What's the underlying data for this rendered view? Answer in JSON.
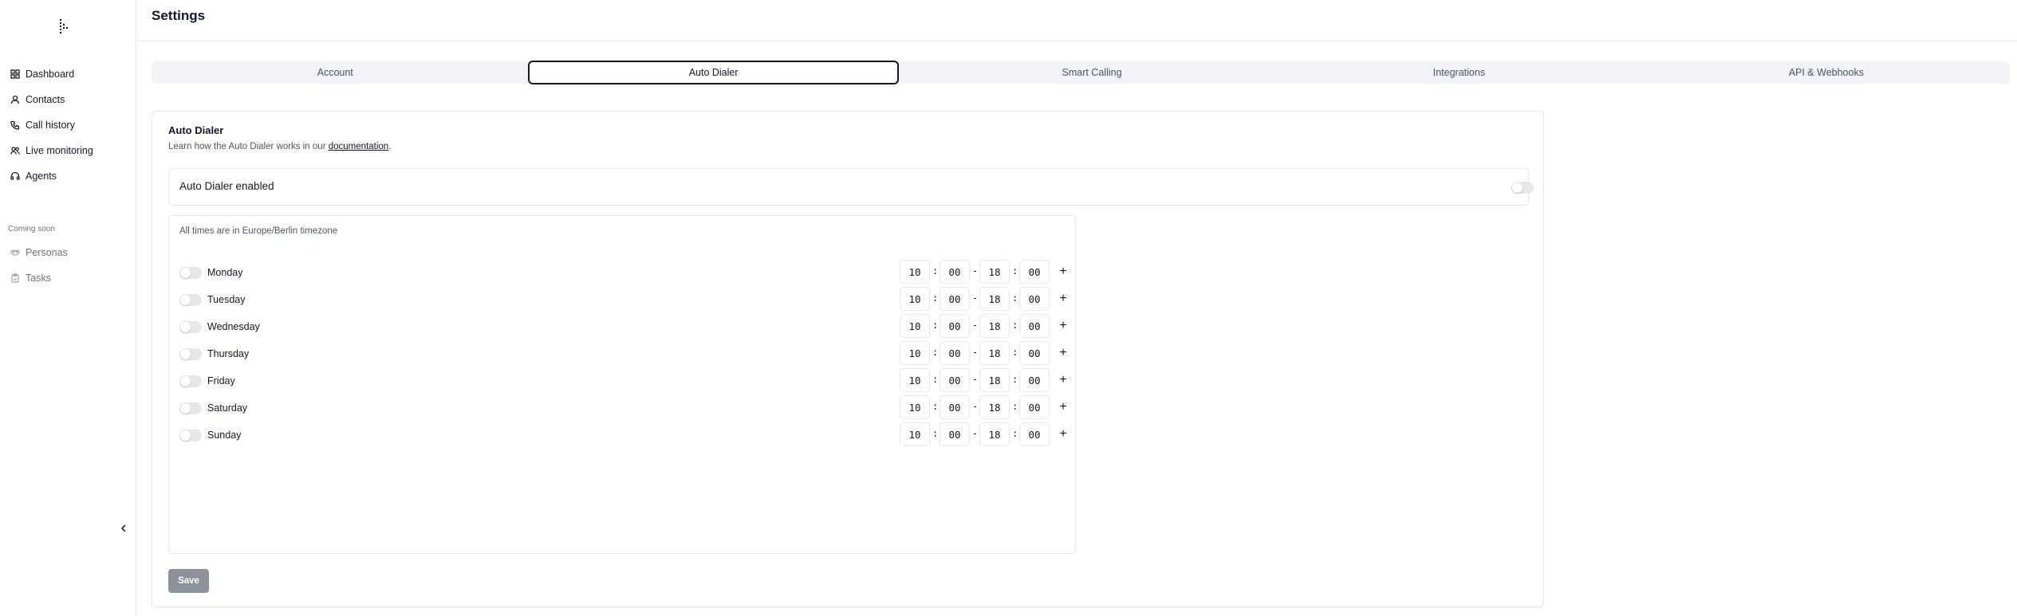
{
  "app": {
    "page_title": "Settings"
  },
  "sidebar": {
    "items": [
      {
        "label": "Dashboard",
        "icon": "grid-icon"
      },
      {
        "label": "Contacts",
        "icon": "user-icon"
      },
      {
        "label": "Call history",
        "icon": "phone-icon"
      },
      {
        "label": "Live monitoring",
        "icon": "users-icon"
      },
      {
        "label": "Agents",
        "icon": "headset-icon"
      }
    ],
    "coming_soon_label": "Coming soon",
    "coming_soon_items": [
      {
        "label": "Personas",
        "icon": "mask-icon"
      },
      {
        "label": "Tasks",
        "icon": "clipboard-icon"
      }
    ]
  },
  "tabs": [
    {
      "label": "Account",
      "active": false
    },
    {
      "label": "Auto Dialer",
      "active": true
    },
    {
      "label": "Smart Calling",
      "active": false
    },
    {
      "label": "Integrations",
      "active": false
    },
    {
      "label": "API & Webhooks",
      "active": false
    }
  ],
  "auto_dialer": {
    "title": "Auto Dialer",
    "desc_prefix": "Learn how the Auto Dialer works in our ",
    "desc_link": "documentation",
    "desc_suffix": ".",
    "enabled_label": "Auto Dialer enabled",
    "enabled": false,
    "timezone_note": "All times are in Europe/Berlin timezone",
    "days": [
      {
        "name": "Monday",
        "enabled": false,
        "start_h": "10",
        "start_m": "00",
        "end_h": "18",
        "end_m": "00"
      },
      {
        "name": "Tuesday",
        "enabled": false,
        "start_h": "10",
        "start_m": "00",
        "end_h": "18",
        "end_m": "00"
      },
      {
        "name": "Wednesday",
        "enabled": false,
        "start_h": "10",
        "start_m": "00",
        "end_h": "18",
        "end_m": "00"
      },
      {
        "name": "Thursday",
        "enabled": false,
        "start_h": "10",
        "start_m": "00",
        "end_h": "18",
        "end_m": "00"
      },
      {
        "name": "Friday",
        "enabled": false,
        "start_h": "10",
        "start_m": "00",
        "end_h": "18",
        "end_m": "00"
      },
      {
        "name": "Saturday",
        "enabled": false,
        "start_h": "10",
        "start_m": "00",
        "end_h": "18",
        "end_m": "00"
      },
      {
        "name": "Sunday",
        "enabled": false,
        "start_h": "10",
        "start_m": "00",
        "end_h": "18",
        "end_m": "00"
      }
    ],
    "time_colon": ":",
    "range_dash": "-",
    "add_symbol": "+",
    "save_label": "Save"
  }
}
